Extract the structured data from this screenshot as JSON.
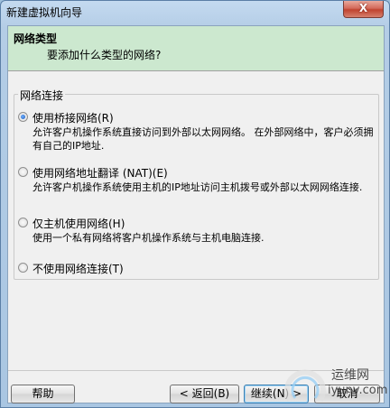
{
  "window": {
    "title": "新建虚拟机向导",
    "close_glyph": "X"
  },
  "header": {
    "title": "网络类型",
    "subtitle": "要添加什么类型的网络?"
  },
  "group": {
    "legend": "网络连接",
    "options": [
      {
        "label": "使用桥接网络(R)",
        "desc": "允许客户机操作系统直接访问到外部以太网网络。 在外部网络中，客户必须拥有自己的IP地址.",
        "checked": true
      },
      {
        "label": "使用网络地址翻译 (NAT)(E)",
        "desc": "允许客户机操作系统使用主机的IP地址访问主机拨号或外部以太网网络连接.",
        "checked": false
      },
      {
        "label": "仅主机使用网络(H)",
        "desc": "使用一个私有网络将客户机操作系统与主机电脑连接.",
        "checked": false
      },
      {
        "label": "不使用网络连接(T)",
        "desc": "",
        "checked": false
      }
    ]
  },
  "buttons": {
    "help": "帮助",
    "back": "< 返回(B)",
    "next": "继续(N) >",
    "cancel": "取消"
  },
  "watermark": {
    "line1": "运维网",
    "line2": "iyunv.com"
  }
}
